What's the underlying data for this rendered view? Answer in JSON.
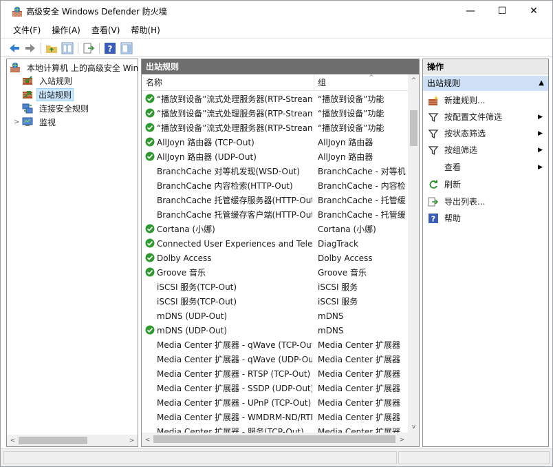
{
  "window": {
    "title": "高级安全 Windows Defender 防火墙",
    "minimize": "—",
    "maximize": "☐",
    "close": "✕"
  },
  "menu": [
    {
      "label": "文件(F)"
    },
    {
      "label": "操作(A)"
    },
    {
      "label": "查看(V)"
    },
    {
      "label": "帮助(H)"
    }
  ],
  "tree": {
    "root": "本地计算机 上的高级安全 Windows Defender 防火墙",
    "items": [
      {
        "label": "入站规则"
      },
      {
        "label": "出站规则"
      },
      {
        "label": "连接安全规则"
      },
      {
        "label": "监视"
      }
    ]
  },
  "center": {
    "header": "出站规则",
    "col_name": "名称",
    "col_group": "组",
    "rows": [
      {
        "name": "“播放到设备”流式处理服务器(RTP-Streaming-Out)",
        "group": "“播放到设备”功能",
        "enabled": true
      },
      {
        "name": "“播放到设备”流式处理服务器(RTP-Streaming-Out)",
        "group": "“播放到设备”功能",
        "enabled": true
      },
      {
        "name": "“播放到设备”流式处理服务器(RTP-Streaming-Out)",
        "group": "“播放到设备”功能",
        "enabled": true
      },
      {
        "name": "AllJoyn 路由器 (TCP-Out)",
        "group": "AllJoyn 路由器",
        "enabled": true
      },
      {
        "name": "AllJoyn 路由器 (UDP-Out)",
        "group": "AllJoyn 路由器",
        "enabled": true
      },
      {
        "name": "BranchCache 对等机发现(WSD-Out)",
        "group": "BranchCache - 对等机发现",
        "enabled": false
      },
      {
        "name": "BranchCache 内容检索(HTTP-Out)",
        "group": "BranchCache - 内容检索",
        "enabled": false
      },
      {
        "name": "BranchCache 托管缓存服务器(HTTP-Out)",
        "group": "BranchCache - 托管缓存服务器",
        "enabled": false
      },
      {
        "name": "BranchCache 托管缓存客户端(HTTP-Out)",
        "group": "BranchCache - 托管缓存客户端",
        "enabled": false
      },
      {
        "name": "Cortana (小娜)",
        "group": "Cortana (小娜)",
        "enabled": true
      },
      {
        "name": "Connected User Experiences and Telemetry",
        "group": "DiagTrack",
        "enabled": true
      },
      {
        "name": "Dolby Access",
        "group": "Dolby Access",
        "enabled": true
      },
      {
        "name": "Groove 音乐",
        "group": "Groove 音乐",
        "enabled": true
      },
      {
        "name": "iSCSI 服务(TCP-Out)",
        "group": "iSCSI 服务",
        "enabled": false
      },
      {
        "name": "iSCSI 服务(TCP-Out)",
        "group": "iSCSI 服务",
        "enabled": false
      },
      {
        "name": "mDNS (UDP-Out)",
        "group": "mDNS",
        "enabled": false
      },
      {
        "name": "mDNS (UDP-Out)",
        "group": "mDNS",
        "enabled": true
      },
      {
        "name": "Media Center 扩展器 - qWave (TCP-Out)",
        "group": "Media Center 扩展器",
        "enabled": false
      },
      {
        "name": "Media Center 扩展器 - qWave (UDP-Out)",
        "group": "Media Center 扩展器",
        "enabled": false
      },
      {
        "name": "Media Center 扩展器 - RTSP (TCP-Out)",
        "group": "Media Center 扩展器",
        "enabled": false
      },
      {
        "name": "Media Center 扩展器 - SSDP (UDP-Out)",
        "group": "Media Center 扩展器",
        "enabled": false
      },
      {
        "name": "Media Center 扩展器 - UPnP (TCP-Out)",
        "group": "Media Center 扩展器",
        "enabled": false
      },
      {
        "name": "Media Center 扩展器 - WMDRM-ND/RTP/RTCP (UDP-Out)",
        "group": "Media Center 扩展器",
        "enabled": false
      },
      {
        "name": "Media Center 扩展器 - 服务(TCP-Out)",
        "group": "Media Center 扩展器",
        "enabled": false
      }
    ]
  },
  "actions": {
    "header": "操作",
    "section": "出站规则",
    "items": [
      {
        "label": "新建规则...",
        "icon": "new-rule-icon",
        "submenu": false
      },
      {
        "label": "按配置文件筛选",
        "icon": "filter-icon",
        "submenu": true
      },
      {
        "label": "按状态筛选",
        "icon": "filter-icon",
        "submenu": true
      },
      {
        "label": "按组筛选",
        "icon": "filter-icon",
        "submenu": true
      },
      {
        "label": "查看",
        "icon": "",
        "submenu": true
      },
      {
        "label": "刷新",
        "icon": "refresh-icon",
        "submenu": false
      },
      {
        "label": "导出列表...",
        "icon": "export-icon",
        "submenu": false
      },
      {
        "label": "帮助",
        "icon": "help-icon",
        "submenu": false
      }
    ]
  },
  "colors": {
    "pane_header_bg": "#6e6e6e",
    "actions_section_bg": "#cde0f5",
    "selection_bg": "#cce8ff",
    "check_green": "#2e9a2e"
  }
}
